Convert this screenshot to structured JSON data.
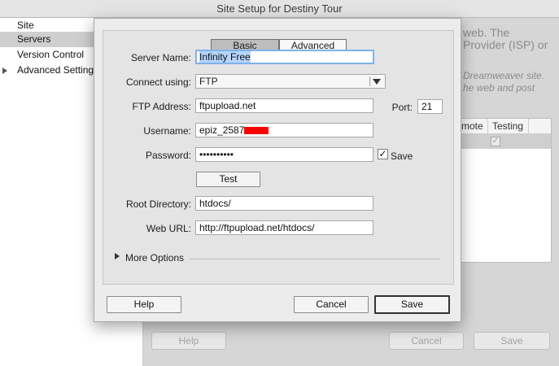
{
  "window": {
    "title": "Site Setup for Destiny Tour"
  },
  "sidebar": {
    "items": [
      {
        "label": "Site"
      },
      {
        "label": "Servers"
      },
      {
        "label": "Version Control"
      },
      {
        "label": "Advanced Settings"
      }
    ]
  },
  "background": {
    "line1": "web. The",
    "line2": "Provider (ISP) or",
    "italic1": "Dreamweaver site.",
    "italic2": "he web and post",
    "table_col_remote": "mote",
    "table_col_testing": "Testing",
    "help_button": "Help",
    "cancel_button": "Cancel",
    "save_button": "Save",
    "testing_check": "✓"
  },
  "dialog": {
    "tabs": {
      "basic": "Basic",
      "advanced": "Advanced"
    },
    "server_name": {
      "label": "Server Name:",
      "value": "Infinity Free"
    },
    "connect_using": {
      "label": "Connect using:",
      "value": "FTP"
    },
    "ftp_address": {
      "label": "FTP Address:",
      "value": "ftpupload.net"
    },
    "port": {
      "label": "Port:",
      "value": "21"
    },
    "username": {
      "label": "Username:",
      "value": "epiz_2587"
    },
    "password": {
      "label": "Password:",
      "value": "••••••••••"
    },
    "save_password": {
      "label": "Save",
      "checked": true,
      "mark": "✓"
    },
    "test_button": "Test",
    "root_directory": {
      "label": "Root Directory:",
      "value": "htdocs/"
    },
    "web_url": {
      "label": "Web URL:",
      "value": "http://ftpupload.net/htdocs/"
    },
    "more_options": "More Options",
    "help_button": "Help",
    "cancel_button": "Cancel",
    "save_button": "Save"
  },
  "colors": {
    "selection_highlight": "#b5d5ff",
    "focus_ring": "#7fb2ea",
    "redaction": "#ff0000"
  }
}
